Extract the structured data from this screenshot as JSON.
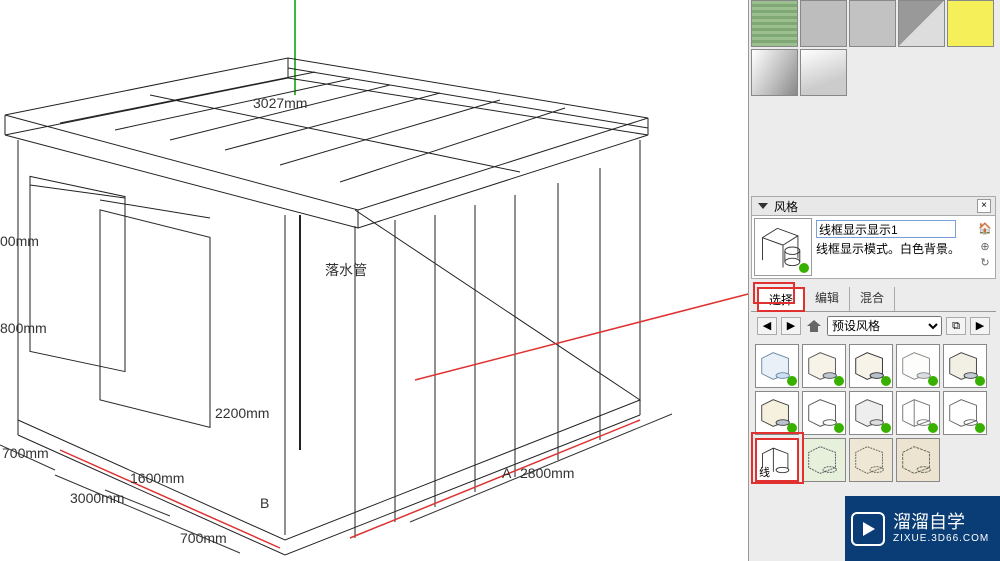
{
  "viewport": {
    "dimensions": {
      "roof_width": "3027mm",
      "downpipe_label": "落水管",
      "door_opening": "2200mm",
      "side_top": "00mm",
      "side_mid": "800mm",
      "left_front": "700mm",
      "front_span": "3000mm",
      "front_small": "1600mm",
      "front_mid_offset": "700mm",
      "right_span": "2800mm",
      "letter_a": "A",
      "letter_b": "B"
    }
  },
  "materials": {
    "row1": [
      "green-stripe",
      "gray-noise",
      "gray-big",
      "diagonal",
      "yellow"
    ],
    "row2": [
      "gradient-1",
      "gradient-2"
    ]
  },
  "styles_panel": {
    "title": "风格",
    "name_value": "线框显示显示1",
    "description": "线框显示模式。白色背景。",
    "tabs": {
      "select": "选择",
      "edit": "编辑",
      "mix": "混合"
    },
    "dropdown_label": "预设风格",
    "thumbnails": [
      {
        "kind": "shaded-xray",
        "badge": true
      },
      {
        "kind": "shaded",
        "badge": true
      },
      {
        "kind": "shaded-edges",
        "badge": true
      },
      {
        "kind": "shaded-light",
        "badge": true
      },
      {
        "kind": "shaded-back",
        "badge": true
      },
      {
        "kind": "shaded-tex",
        "badge": true
      },
      {
        "kind": "hidden-line",
        "badge": true
      },
      {
        "kind": "mono",
        "badge": true
      },
      {
        "kind": "wire-xray",
        "badge": true
      },
      {
        "kind": "wireframe",
        "badge": true,
        "selected": true,
        "sub_label": "线"
      },
      {
        "kind": "sketchy-1",
        "badge": false
      },
      {
        "kind": "sketchy-2",
        "badge": false
      },
      {
        "kind": "sketchy-3",
        "badge": false
      }
    ]
  },
  "watermark": {
    "brand": "溜溜自学",
    "url": "ZIXUE.3D66.COM"
  }
}
